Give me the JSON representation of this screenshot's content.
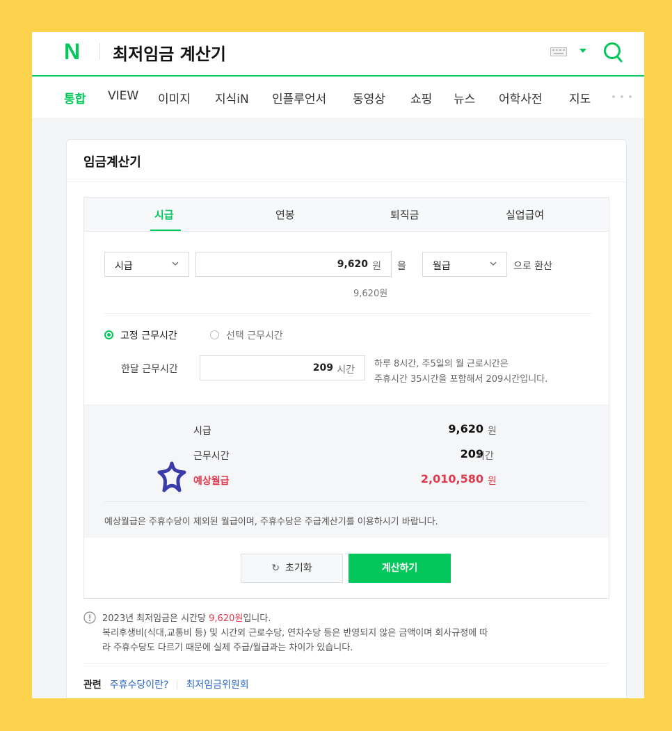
{
  "header": {
    "logo": "N",
    "query": "최저임금 계산기",
    "icons": [
      "keyboard-icon",
      "dropdown-caret-icon",
      "search-icon"
    ]
  },
  "tabs": [
    {
      "label": "통합",
      "active": true
    },
    {
      "label": "VIEW"
    },
    {
      "label": "이미지"
    },
    {
      "label": "지식iN"
    },
    {
      "label": "인플루언서"
    },
    {
      "label": "동영상"
    },
    {
      "label": "쇼핑"
    },
    {
      "label": "뉴스"
    },
    {
      "label": "어학사전"
    },
    {
      "label": "지도"
    }
  ],
  "card": {
    "title": "임금계산기",
    "calc_tabs": [
      {
        "label": "시급",
        "active": true
      },
      {
        "label": "연봉"
      },
      {
        "label": "퇴직금"
      },
      {
        "label": "실업급여"
      }
    ],
    "convert": {
      "from_select": "시급",
      "amount": "9,620",
      "amount_unit": "원",
      "particle": "을",
      "to_select": "월급",
      "suffix": "으로 환산",
      "amount_hint": "9,620원"
    },
    "hours": {
      "option_fixed": "고정 근무시간",
      "option_select": "선택 근무시간",
      "label": "한달 근무시간",
      "value": "209",
      "unit": "시간",
      "hint_line1": "하루 8시간, 주5일의 월 근로시간은",
      "hint_line2": "주휴시간 35시간을 포함해서 209시간입니다."
    },
    "result": {
      "rows": [
        {
          "label": "시급",
          "value": "9,620",
          "unit": "원"
        },
        {
          "label": "근무시간",
          "value": "209",
          "unit": "시간"
        },
        {
          "label": "예상월급",
          "value": "2,010,580",
          "unit": "원"
        }
      ],
      "note": "예상월급은 주휴수당이 제외된 월급이며, 주휴수당은 주급계산기를 이용하시기 바랍니다."
    },
    "buttons": {
      "reset": "초기화",
      "calc": "계산하기"
    },
    "info": {
      "line1_pre": "2023년 최저임금은 시간당 ",
      "line1_hl": "9,620원",
      "line1_post": "입니다.",
      "line2": "복리후생비(식대,교통비 등) 및 시간외 근로수당, 연차수당 등은 반영되지 않은 금액이며 회사규정에 따",
      "line3": "라 주휴수당도 다르기 때문에 실제 주급/월급과는 차이가 있습니다."
    },
    "related": {
      "title": "관련",
      "links": [
        "주휴수당이란?",
        "최저임금위원회"
      ]
    }
  },
  "colors": {
    "brand": "#03c75a",
    "highlight": "#e0394b",
    "background": "#fdd24d",
    "sticker": "#3a3aa8"
  }
}
